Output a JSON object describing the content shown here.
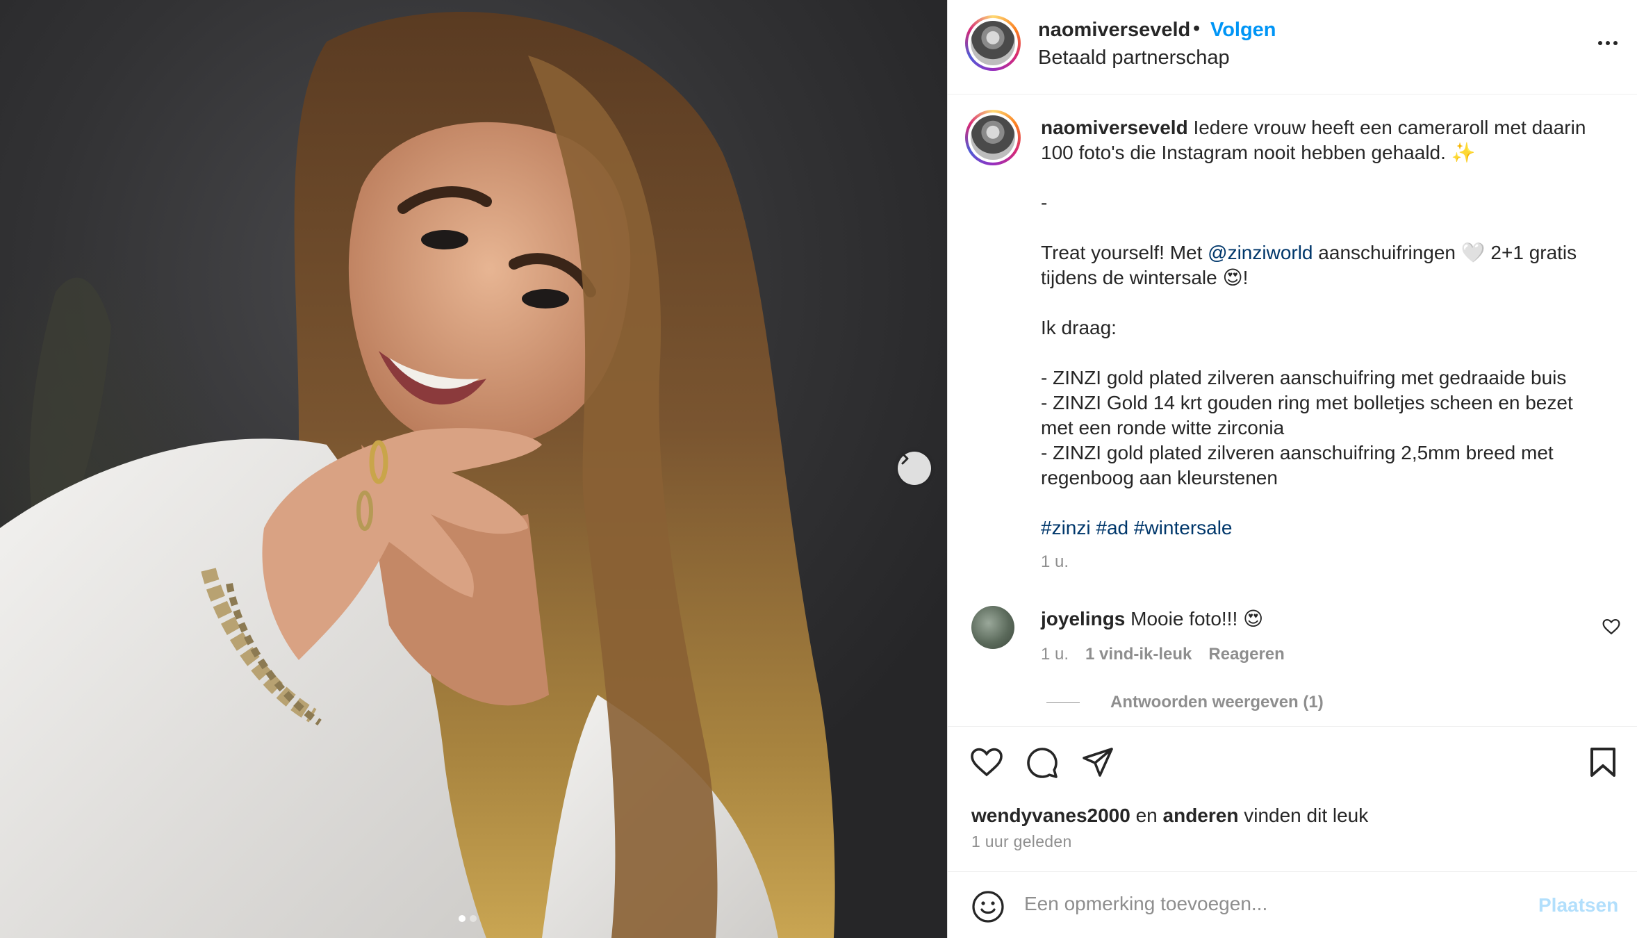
{
  "post": {
    "username": "naomiverseveld",
    "separator": "•",
    "follow_label": "Volgen",
    "subtitle": "Betaald partnerschap",
    "carousel_total": 2,
    "carousel_active": 1
  },
  "caption": {
    "username": "naomiverseveld",
    "line1": "Iedere vrouw heeft een cameraroll met daarin 100 foto's die Instagram nooit hebben gehaald. ✨",
    "dash": "-",
    "treat_pre": "Treat yourself! Met ",
    "mention": "@zinziworld",
    "treat_post": " aanschuifringen 🤍 2+1 gratis tijdens de wintersale 😍!",
    "wearing": "Ik draag:",
    "item1": "- ZINZI gold plated zilveren aanschuifring met gedraaide buis",
    "item2": "- ZINZI Gold 14 krt gouden ring met bolletjes scheen en bezet met een ronde witte zirconia",
    "item3": "- ZINZI gold plated zilveren aanschuifring 2,5mm breed met regenboog aan kleurstenen",
    "tag1": "#zinzi",
    "tag2": "#ad",
    "tag3": "#wintersale",
    "time": "1 u."
  },
  "comment": {
    "username": "joyelings",
    "text": "Mooie foto!!! 😍",
    "time": "1 u.",
    "likes": "1 vind-ik-leuk",
    "reply": "Reageren",
    "view_replies": "Antwoorden weergeven (1)"
  },
  "likes": {
    "user": "wendyvanes2000",
    "and": " en ",
    "others": "anderen",
    "suffix": " vinden dit leuk",
    "posted": "1 uur geleden"
  },
  "add_comment": {
    "placeholder": "Een opmerking toevoegen...",
    "post_label": "Plaatsen"
  },
  "colors": {
    "link_blue": "#0095f6",
    "mention_blue": "#00376b",
    "muted": "#8e8e8e",
    "post_disabled": "#b2dffc"
  },
  "icons": [
    "chevron-right-icon",
    "more-icon",
    "heart-icon",
    "comment-icon",
    "share-icon",
    "bookmark-icon",
    "emoji-icon"
  ]
}
